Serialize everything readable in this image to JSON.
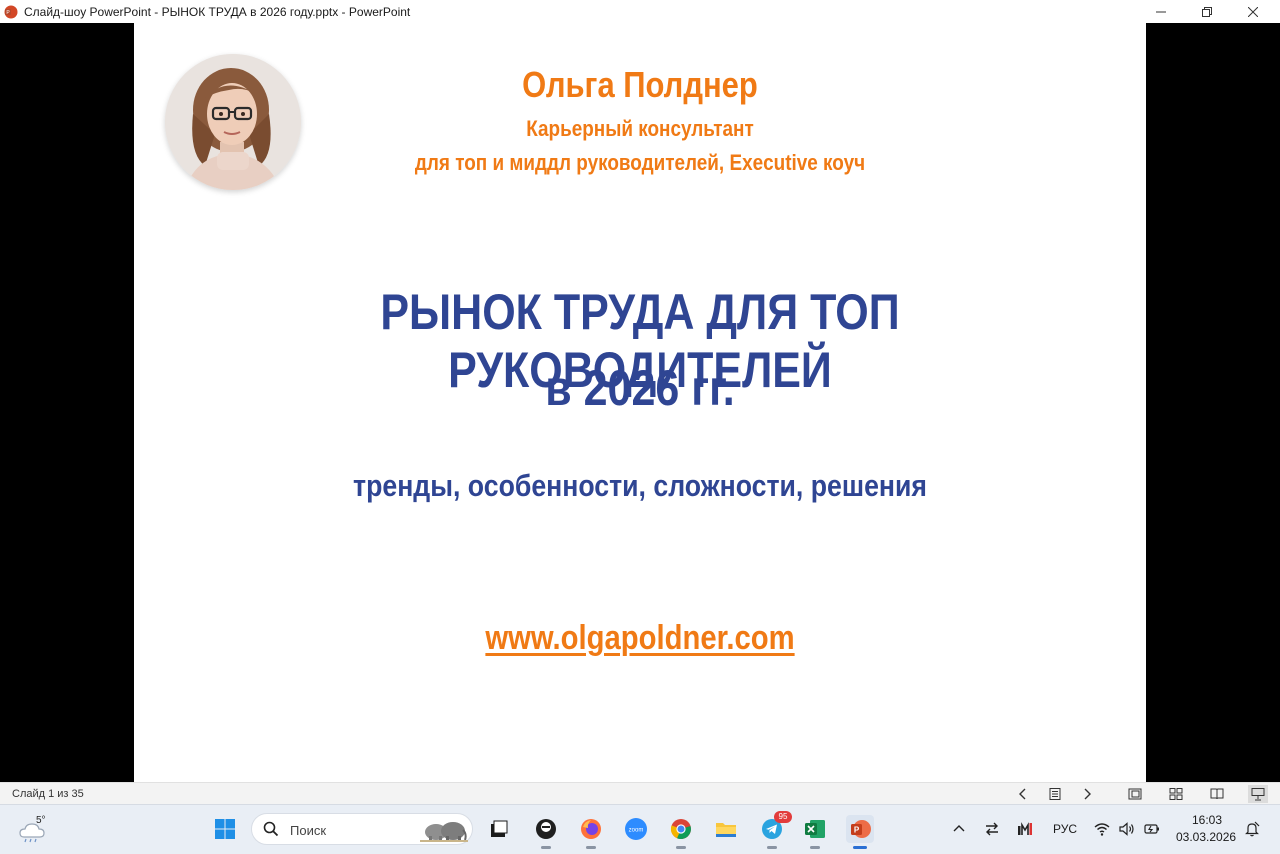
{
  "window": {
    "title": "Слайд-шоу PowerPoint  -  РЫНОК ТРУДА в 2026 году.pptx - PowerPoint"
  },
  "slide": {
    "name": "Ольга Полднер",
    "role_line1": "Карьерный консультант",
    "role_line2": "для топ и миддл руководителей, Executive коуч",
    "title_line1": "РЫНОК ТРУДА ДЛЯ ТОП РУКОВОДИТЕЛЕЙ",
    "title_line2": "в 2026 гг.",
    "subtitle": "тренды, особенности, сложности, решения",
    "website": "www.olgapoldner.com"
  },
  "statusbar": {
    "slide_counter": "Слайд 1 из 35"
  },
  "taskbar": {
    "weather_temp": "5°",
    "search_placeholder": "Поиск",
    "telegram_badge": "95",
    "language": "РУС",
    "time": "16:03",
    "date": "03.03.2026"
  },
  "colors": {
    "accent_orange": "#f07a15",
    "title_blue": "#2f4593"
  },
  "icons": {
    "taskbar": [
      "windows-start-icon",
      "search-icon",
      "task-view-icon",
      "app-icon",
      "firefox-icon",
      "zoom-icon",
      "chrome-icon",
      "file-explorer-icon",
      "telegram-icon",
      "excel-icon",
      "powerpoint-icon"
    ],
    "tray": [
      "chevron-up-icon",
      "arrows-icon",
      "meter-icon",
      "wifi-icon",
      "volume-icon",
      "battery-icon",
      "notification-icon"
    ]
  }
}
